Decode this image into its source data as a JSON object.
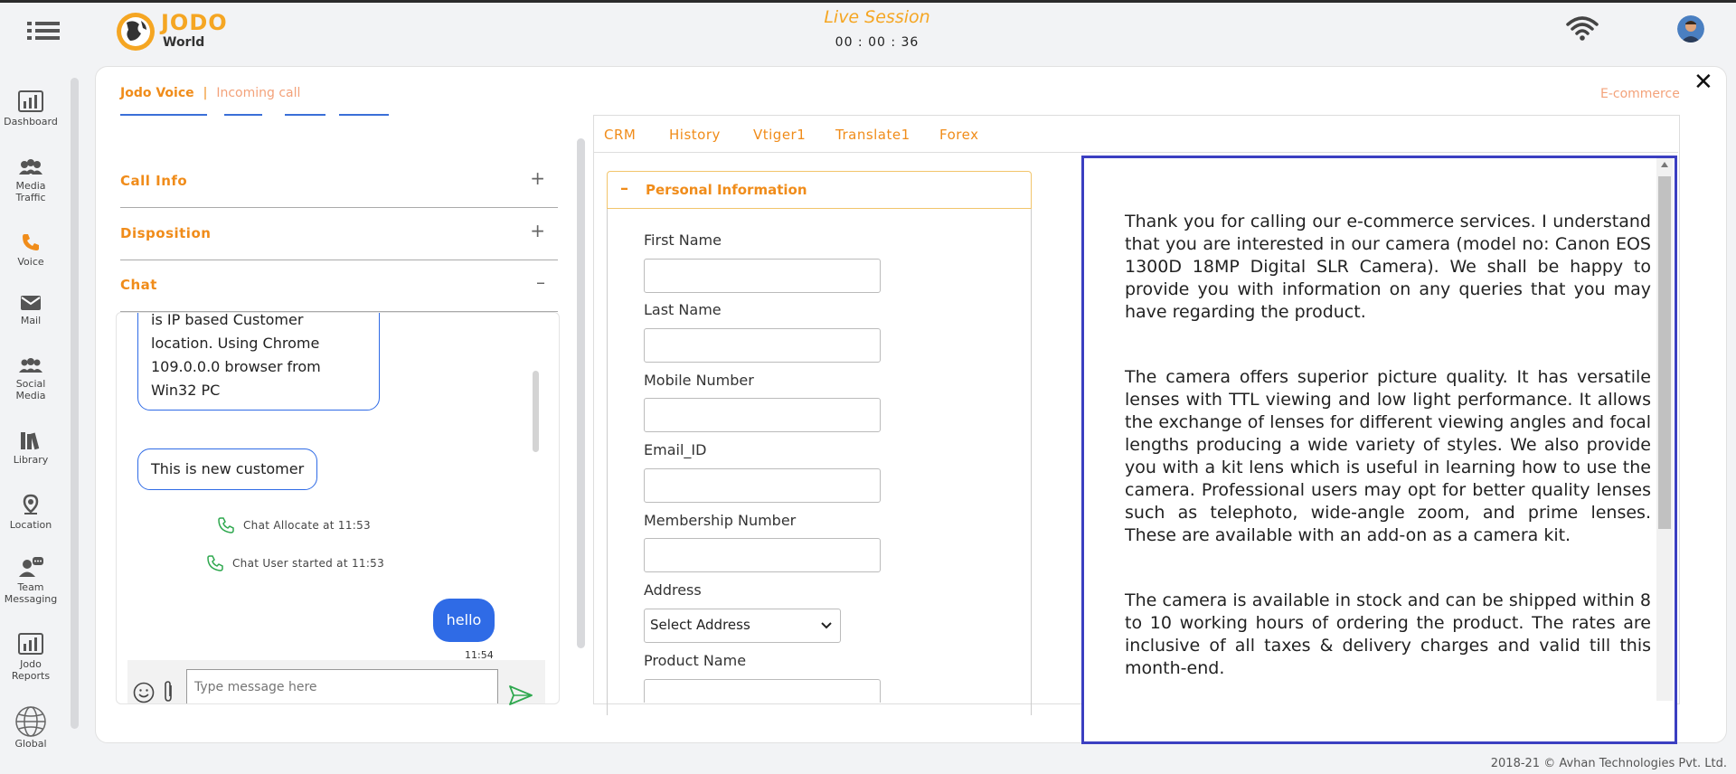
{
  "header": {
    "logo_line1": "JODO",
    "logo_line2": "World",
    "session_title": "Live Session",
    "session_timer": "00 : 00 : 36"
  },
  "sidebar": {
    "items": [
      {
        "label": "Dashboard",
        "icon": "dashboard-icon"
      },
      {
        "label": "Media Traffic",
        "icon": "media-traffic-icon"
      },
      {
        "label": "Voice",
        "icon": "phone-icon",
        "active": true
      },
      {
        "label": "Mail",
        "icon": "mail-icon"
      },
      {
        "label": "Social Media",
        "icon": "social-media-icon"
      },
      {
        "label": "Library",
        "icon": "library-icon"
      },
      {
        "label": "Location",
        "icon": "location-icon"
      },
      {
        "label": "Team Messaging",
        "icon": "team-messaging-icon"
      },
      {
        "label": "Jodo Reports",
        "icon": "reports-icon"
      },
      {
        "label": "Global",
        "icon": "globe-icon"
      }
    ]
  },
  "breadcrumb": {
    "primary": "Jodo Voice",
    "separator": "|",
    "secondary": "Incoming call",
    "right_label": "E-commerce"
  },
  "accordion": {
    "call_info": {
      "title": "Call Info",
      "sign": "+"
    },
    "disposition": {
      "title": "Disposition",
      "sign": "+"
    },
    "chat": {
      "title": "Chat",
      "sign": "–"
    }
  },
  "chat": {
    "incoming_1": [
      "is IP based Customer",
      "location. Using Chrome",
      "109.0.0.0 browser from",
      "Win32 PC"
    ],
    "incoming_2": "This is new customer",
    "system_1": "Chat Allocate at 11:53",
    "system_2": "Chat User started at 11:53",
    "outgoing": "hello",
    "outgoing_time": "11:54",
    "placeholder": "Type message here"
  },
  "tabs": [
    "CRM",
    "History",
    "Vtiger1",
    "Translate1",
    "Forex"
  ],
  "personal_info": {
    "title": "Personal Information",
    "fields": [
      "First Name",
      "Last Name",
      "Mobile Number",
      "Email_ID",
      "Membership Number"
    ],
    "address_label": "Address",
    "address_select": "Select Address",
    "product_label": "Product Name"
  },
  "translation": {
    "paragraphs": [
      "Thank you for calling our e-commerce services. I understand that you are interested in our camera (model no: Canon EOS 1300D 18MP Digital SLR Camera). We shall be happy to provide you with information on any queries that you may have regarding the product.",
      "The camera offers superior picture quality. It has versatile lenses with TTL viewing and low light performance. It allows the exchange of lenses for different viewing angles and focal lengths producing a wide variety of styles. We also provide you with a kit lens which is useful in learning how to use the camera. Professional users may opt for better quality lenses such as telephoto, wide-angle zoom, and prime lenses. These are available with an add-on as a camera kit.",
      "The camera is available in stock and can be shipped within 8 to 10 working hours of ordering the product. The rates are inclusive of all taxes & delivery charges and valid till this month-end."
    ]
  },
  "footer": "2018-21 © Avhan Technologies Pvt. Ltd."
}
